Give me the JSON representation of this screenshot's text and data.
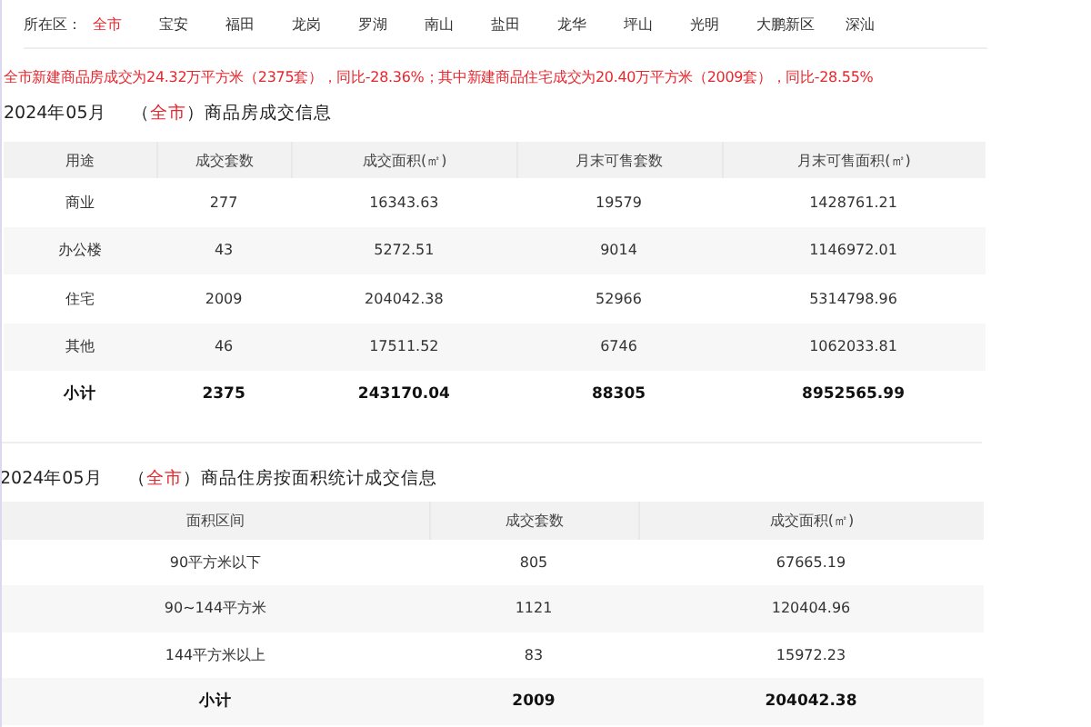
{
  "district_filter": {
    "label": "所在区：",
    "items": [
      {
        "label": "全市",
        "selected": true
      },
      {
        "label": "宝安",
        "selected": false
      },
      {
        "label": "福田",
        "selected": false
      },
      {
        "label": "龙岗",
        "selected": false
      },
      {
        "label": "罗湖",
        "selected": false
      },
      {
        "label": "南山",
        "selected": false
      },
      {
        "label": "盐田",
        "selected": false
      },
      {
        "label": "龙华",
        "selected": false
      },
      {
        "label": "坪山",
        "selected": false
      },
      {
        "label": "光明",
        "selected": false
      },
      {
        "label": "大鹏新区",
        "selected": false
      },
      {
        "label": "深汕",
        "selected": false
      }
    ]
  },
  "summary": "全市新建商品房成交为24.32万平方米（2375套），同比-28.36%；其中新建商品住宅成交为20.40万平方米（2009套），同比-28.55%",
  "sections": [
    {
      "title": {
        "period": "2024年05月",
        "open": "（",
        "region": "全市",
        "close": "）",
        "text": "商品房成交信息"
      },
      "table": {
        "columns": [
          "用途",
          "成交套数",
          "成交面积(㎡)",
          "月末可售套数",
          "月末可售面积(㎡)"
        ],
        "rows": [
          {
            "kind": "data",
            "cells": [
              "商业",
              "277",
              "16343.63",
              "19579",
              "1428761.21"
            ]
          },
          {
            "kind": "data",
            "cells": [
              "办公楼",
              "43",
              "5272.51",
              "9014",
              "1146972.01"
            ]
          },
          {
            "kind": "data",
            "cells": [
              "住宅",
              "2009",
              "204042.38",
              "52966",
              "5314798.96"
            ]
          },
          {
            "kind": "data",
            "cells": [
              "其他",
              "46",
              "17511.52",
              "6746",
              "1062033.81"
            ]
          },
          {
            "kind": "total",
            "cells": [
              "小计",
              "2375",
              "243170.04",
              "88305",
              "8952565.99"
            ]
          }
        ]
      }
    },
    {
      "title": {
        "period": "2024年05月",
        "open": "（",
        "region": "全市",
        "close": "）",
        "text": "商品住房按面积统计成交信息"
      },
      "table": {
        "columns": [
          "面积区间",
          "成交套数",
          "成交面积(㎡)"
        ],
        "rows": [
          {
            "kind": "data",
            "cells": [
              "90平方米以下",
              "805",
              "67665.19"
            ]
          },
          {
            "kind": "data",
            "cells": [
              "90~144平方米",
              "1121",
              "120404.96"
            ]
          },
          {
            "kind": "data",
            "cells": [
              "144平方米以上",
              "83",
              "15972.23"
            ]
          },
          {
            "kind": "total",
            "cells": [
              "小计",
              "2009",
              "204042.38"
            ]
          }
        ]
      }
    }
  ]
}
